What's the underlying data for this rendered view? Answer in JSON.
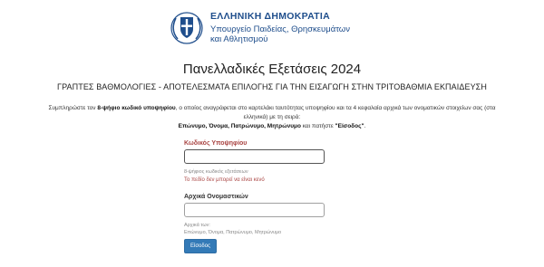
{
  "header": {
    "gov_title": "ΕΛΛΗΝΙΚΗ ΔΗΜΟΚΡΑΤΙΑ",
    "ministry_line1": "Υπουργείο Παιδείας, Θρησκευμάτων",
    "ministry_line2": "και Αθλητισμού"
  },
  "page": {
    "title": "Πανελλαδικές Εξετάσεις 2024",
    "subtitle": "ΓΡΑΠΤΕΣ ΒΑΘΜΟΛΟΓΙΕΣ - ΑΠΟΤΕΛΕΣΜΑΤΑ ΕΠΙΛΟΓΗΣ ΓΙΑ ΤΗΝ ΕΙΣΑΓΩΓΗ ΣΤΗΝ ΤΡΙΤΟΒΑΘΜΙΑ ΕΚΠΑΙΔΕΥΣΗ"
  },
  "instructions": {
    "part1": "Συμπληρώστε τον ",
    "bold1": "8-ψήφιο κωδικό υποψηφίου",
    "part2": ", ο οποίος αναγράφεται στο καρτελάκι ταυτότητας υποψηφίου και τα 4 κεφαλαία αρχικά των ονοματικών στοιχείων σας (στα",
    "part3": "ελληνικά) με τη σειρά:",
    "bold2": "Επώνυμο, Όνομα, Πατρώνυμο, Μητρώνυμο",
    "part4": " και πατήστε ",
    "bold3": "\"Είσοδος\"",
    "part5": "."
  },
  "form": {
    "code_label": "Κωδικός Υποψηφίου",
    "code_value": "",
    "code_help": "8-ψήφιος κωδικός εξετάσεων",
    "code_error": "Το πεδίο δεν μπορεί να είναι κενό",
    "initials_label": "Αρχικά Ονομαστικών",
    "initials_value": "",
    "initials_help1": "Αρχικά των:",
    "initials_help2": "Επώνυμο, Όνομα, Πατρώνυμο, Μητρώνυμο",
    "submit_label": "Είσοδος"
  },
  "colors": {
    "brand": "#1f4e8c",
    "error": "#a94442",
    "button": "#337ab7"
  }
}
